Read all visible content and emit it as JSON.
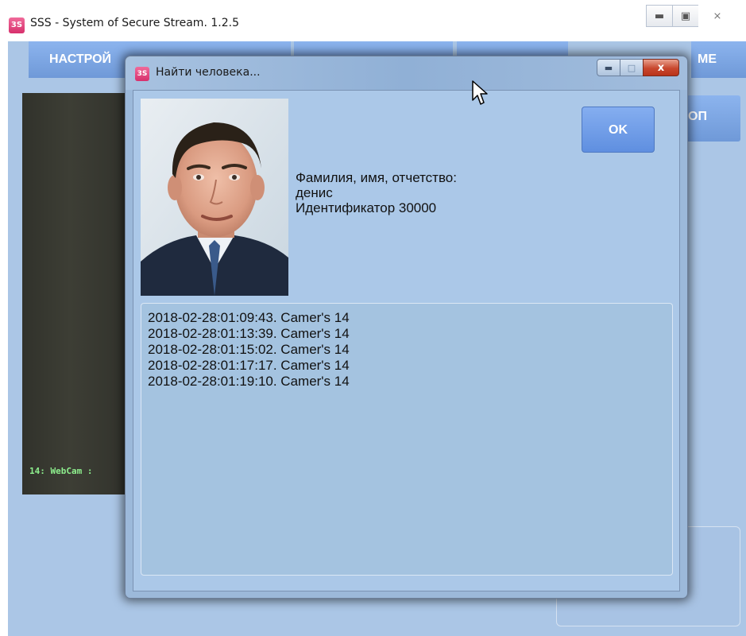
{
  "main_window": {
    "title": "SSS - System of Secure Stream. 1.2.5",
    "app_icon_text": "3S",
    "controls": {
      "minimize_icon": "minimize-icon",
      "maximize_icon": "maximize-icon",
      "close_icon": "close-icon"
    },
    "menu": {
      "settings_label": "НАСТРОЙ",
      "right_label": "МЕ"
    },
    "side_button_label": "ОП",
    "video_caption": "14: WebCam :"
  },
  "dialog": {
    "title": "Найти человека...",
    "app_icon_text": "3S",
    "close_glyph": "x",
    "ok_label": "OK",
    "info": {
      "fio_label": "Фамилия, имя, отчетство:",
      "name": "денис",
      "identifier": "Идентификатор 30000"
    },
    "log": [
      "2018-02-28:01:09:43. Camer's 14",
      "2018-02-28:01:13:39. Camer's 14",
      "2018-02-28:01:15:02. Camer's 14",
      "2018-02-28:01:17:17. Camer's 14",
      "2018-02-28:01:19:10. Camer's 14"
    ]
  },
  "colors": {
    "client_background": "#abc6e6",
    "button_blue": "#7ea6e2",
    "close_red": "#c8472e",
    "video_text": "#8ef08e"
  },
  "icons": {
    "app": "sss-app-icon",
    "cursor": "mouse-cursor-icon"
  }
}
